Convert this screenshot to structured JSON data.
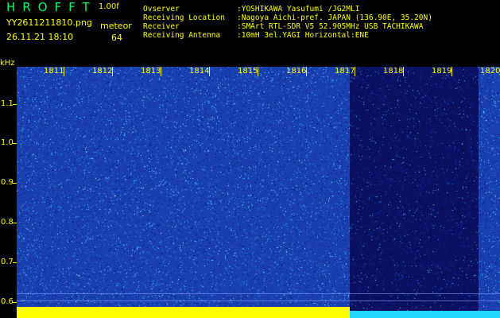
{
  "header": {
    "app_name": "HROFFT",
    "version": "1.00f",
    "filename": "YY2611211810.png",
    "event_type": "meteor",
    "datetime": "26.11.21 18:10",
    "count": "64"
  },
  "station_info": [
    {
      "key": "Ovserver",
      "value": ":YOSHIKAWA Yasufumi /JG2MLI"
    },
    {
      "key": "Receiving Location",
      "value": ":Nagoya Aichi-pref. JAPAN (136.90E, 35.20N)"
    },
    {
      "key": "Receiver",
      "value": ":SMArt RTL-SDR V5 52.905MHz USB TACHIKAWA"
    },
    {
      "key": "Receiving Antenna",
      "value": ":10mH 3el.YAGI Horizontal:ENE"
    }
  ],
  "spectrogram": {
    "y_unit": "kHz",
    "y_ticks": [
      "1.1",
      "1.0",
      "0.9",
      "0.8",
      "0.7",
      "0.6"
    ],
    "x_ticks": [
      "1811",
      "1812",
      "1813",
      "1814",
      "1815",
      "1816",
      "1817",
      "1818",
      "1819",
      "1820"
    ],
    "colors": {
      "background": "#000000",
      "label": "#ffff00",
      "title": "#00ff66",
      "noise": "#1a3fb0",
      "noise_dark": "#0a1060"
    }
  }
}
